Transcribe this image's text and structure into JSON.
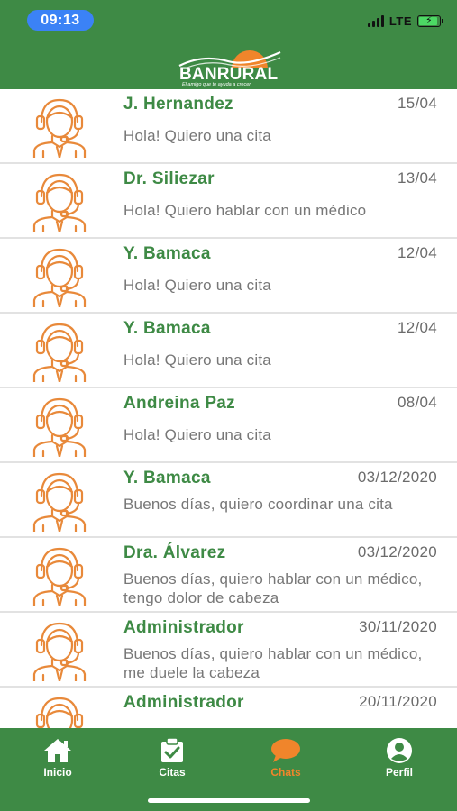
{
  "status_bar": {
    "time": "09:13",
    "network": "LTE"
  },
  "header": {
    "logo_name": "BANRURAL",
    "logo_tagline": "El amigo que te ayuda a crecer"
  },
  "chats": [
    {
      "name": "J. Hernandez",
      "date": "15/04",
      "message": "Hola! Quiero una cita"
    },
    {
      "name": "Dr. Siliezar",
      "date": "13/04",
      "message": "Hola! Quiero hablar con un médico"
    },
    {
      "name": "Y. Bamaca",
      "date": "12/04",
      "message": "Hola! Quiero una cita"
    },
    {
      "name": "Y. Bamaca",
      "date": "12/04",
      "message": "Hola! Quiero una cita"
    },
    {
      "name": "Andreina Paz",
      "date": "08/04",
      "message": "Hola! Quiero una cita"
    },
    {
      "name": "Y. Bamaca",
      "date": "03/12/2020",
      "message": "Buenos días, quiero coordinar una cita"
    },
    {
      "name": "Dra. Álvarez",
      "date": "03/12/2020",
      "message": "Buenos días, quiero hablar con un médico, tengo dolor de cabeza"
    },
    {
      "name": "Administrador",
      "date": "30/11/2020",
      "message": "Buenos días, quiero hablar con un médico, me duele la cabeza"
    },
    {
      "name": "Administrador",
      "date": "20/11/2020",
      "message": ""
    }
  ],
  "tabs": [
    {
      "label": "Inicio",
      "icon": "home-icon",
      "active": false
    },
    {
      "label": "Citas",
      "icon": "calendar-check-icon",
      "active": false
    },
    {
      "label": "Chats",
      "icon": "chat-bubble-icon",
      "active": true
    },
    {
      "label": "Perfil",
      "icon": "user-icon",
      "active": false
    }
  ],
  "colors": {
    "brand_green": "#3e8a45",
    "accent_orange": "#f0852b",
    "time_pill_blue": "#3b82f6",
    "message_gray": "#777777"
  }
}
